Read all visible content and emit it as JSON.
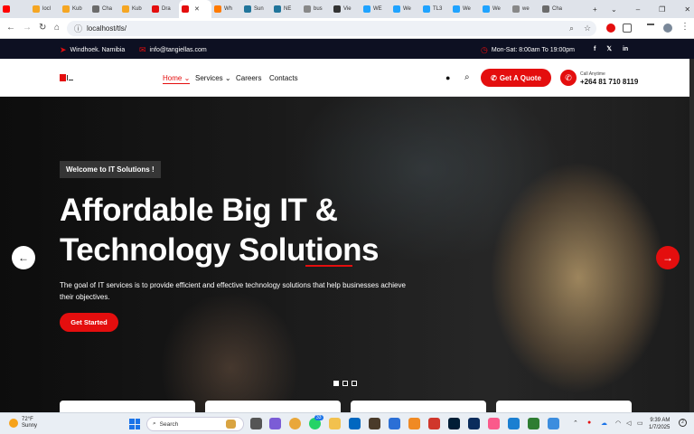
{
  "browser": {
    "tabs": [
      {
        "label": "",
        "fav": "#ff0000"
      },
      {
        "label": "locl",
        "fav": "#f5a623"
      },
      {
        "label": "Kub",
        "fav": "#f5a623"
      },
      {
        "label": "Cha",
        "fav": "#6b6b6b"
      },
      {
        "label": "Kub",
        "fav": "#f5a623"
      },
      {
        "label": "Dra",
        "fav": "#e40e0e"
      },
      {
        "label": "",
        "fav": "#e40e0e",
        "active": true
      },
      {
        "label": "Wh",
        "fav": "#ff7a00"
      },
      {
        "label": "Sun",
        "fav": "#21759b"
      },
      {
        "label": "NE",
        "fav": "#21759b"
      },
      {
        "label": "bus",
        "fav": "#888888"
      },
      {
        "label": "Vie",
        "fav": "#333333"
      },
      {
        "label": "WE",
        "fav": "#1fa3ff"
      },
      {
        "label": "We",
        "fav": "#1fa3ff"
      },
      {
        "label": "TL3",
        "fav": "#1fa3ff"
      },
      {
        "label": "We",
        "fav": "#1fa3ff"
      },
      {
        "label": "We",
        "fav": "#1fa3ff"
      },
      {
        "label": "we",
        "fav": "#888888"
      },
      {
        "label": "Cha",
        "fav": "#6b6b6b"
      }
    ],
    "new_tab_glyph": "+",
    "window_controls": [
      "⌄",
      "–",
      "❐",
      "✕"
    ],
    "url": "localhost/tls/",
    "nav": {
      "back": "←",
      "forward": "→",
      "reload": "↻",
      "home": "⌂"
    }
  },
  "topbar": {
    "location": "Windhoek. Namibia",
    "email": "info@tangiellas.com",
    "hours": "Mon-Sat: 8:00am To 19:00pm",
    "social": [
      "f",
      "𝕏",
      "in"
    ]
  },
  "nav": {
    "links": [
      "Home",
      "Services",
      "Careers",
      "Contacts"
    ],
    "quote_label": "Get A Quote",
    "call_label": "Call Anytime",
    "call_number": "+264 81 710 8119"
  },
  "hero": {
    "welcome": "Welcome to IT Solutions !",
    "heading_line1": "Affordable Big IT &",
    "heading_line2": "Technology Solutions",
    "description": "The goal of IT services is to provide efficient and effective technology solutions that help businesses achieve their objectives.",
    "cta": "Get Started",
    "slide_current": 1,
    "slide_total": 3
  },
  "taskbar": {
    "weather_temp": "72°F",
    "weather_desc": "Sunny",
    "search_placeholder": "Search",
    "time": "9:39 AM",
    "date": "1/7/2025",
    "badge_count": "33"
  },
  "colors": {
    "accent": "#e40e0e",
    "topbar_bg": "#0d1022"
  }
}
